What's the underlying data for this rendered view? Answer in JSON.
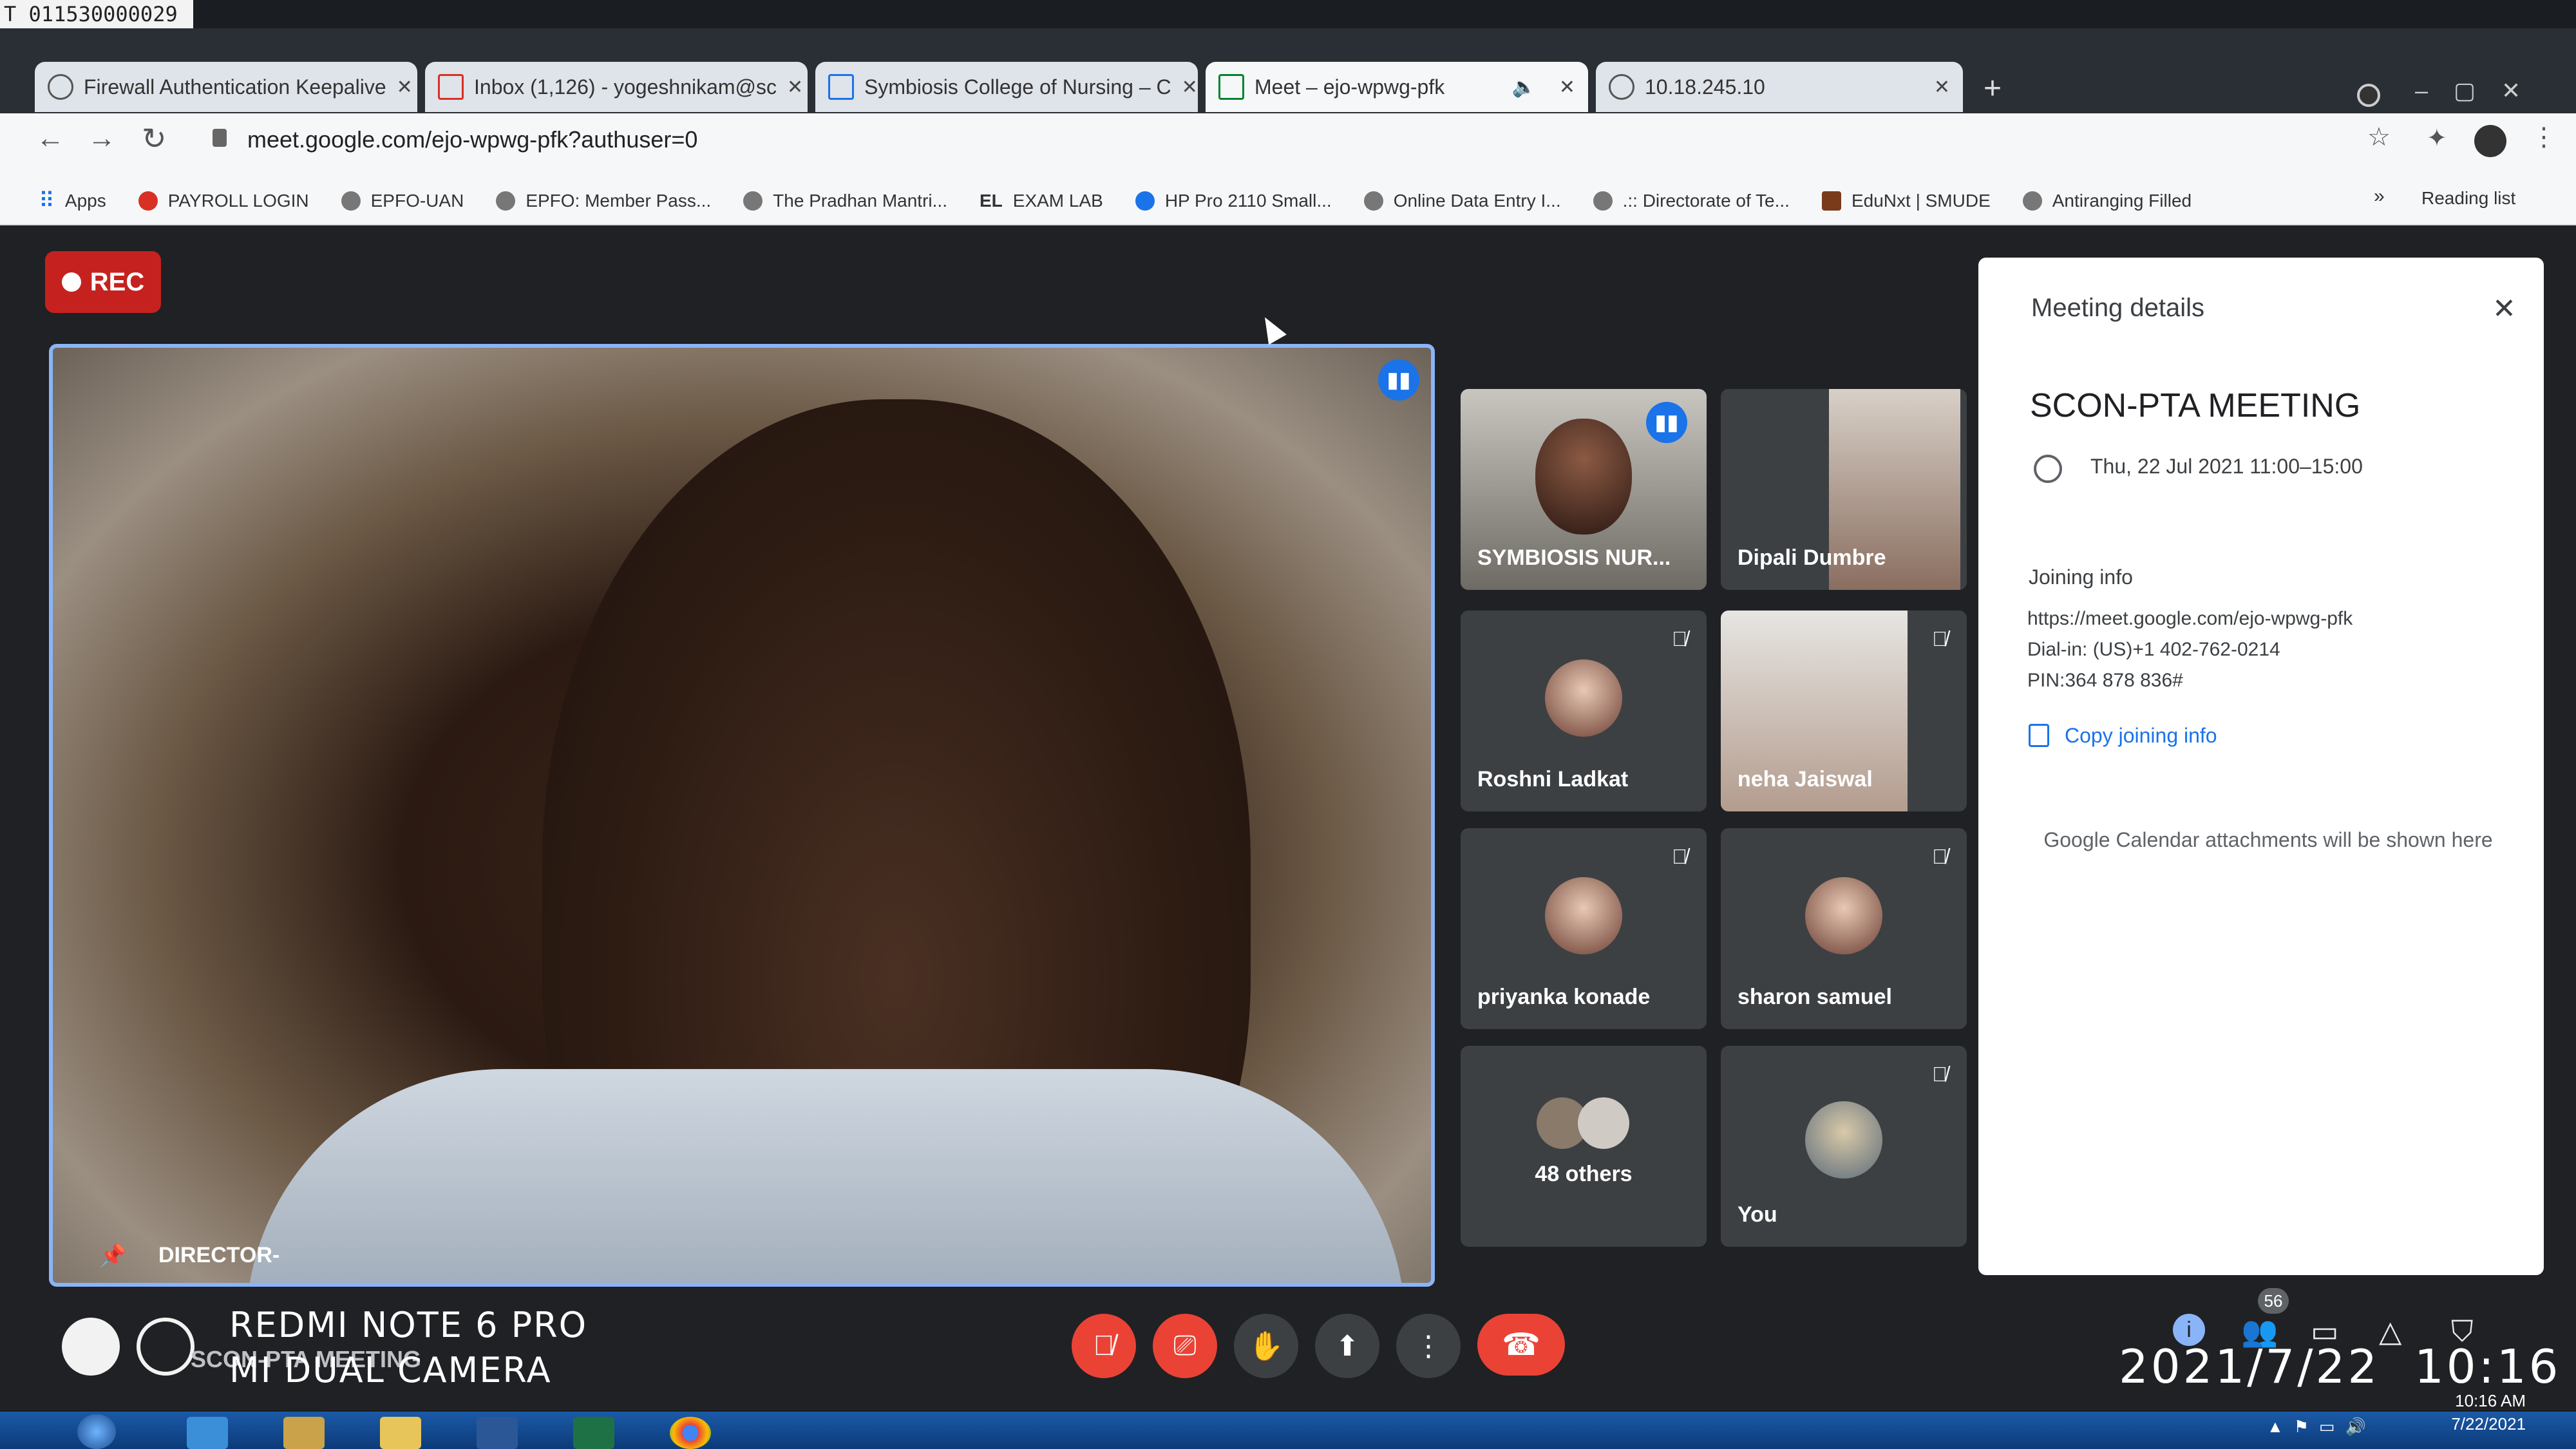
{
  "corner_label": "T 011530000029",
  "tabs": [
    {
      "title": "Firewall Authentication Keepalive"
    },
    {
      "title": "Inbox (1,126) - yogeshnikam@sc"
    },
    {
      "title": "Symbiosis College of Nursing – C"
    },
    {
      "title": "Meet – ejo-wpwg-pfk"
    },
    {
      "title": "10.18.245.10"
    }
  ],
  "address_bar": {
    "url": "meet.google.com/ejo-wpwg-pfk?authuser=0"
  },
  "bookmarks": [
    "Apps",
    "PAYROLL LOGIN",
    "EPFO-UAN",
    "EPFO: Member Pass...",
    "The Pradhan Mantri...",
    "EXAM LAB",
    "HP Pro 2110 Small...",
    "Online Data Entry I...",
    ".:: Directorate of Te...",
    "EduNxt | SMUDE",
    "Antiranging Filled"
  ],
  "reading_list": "Reading list",
  "rec_label": "REC",
  "main_speaker": {
    "name": "DIRECTOR-"
  },
  "participants": [
    {
      "name": "SYMBIOSIS NUR..."
    },
    {
      "name": "Dipali Dumbre"
    },
    {
      "name": "Roshni Ladkat"
    },
    {
      "name": "neha Jaiswal"
    },
    {
      "name": "priyanka konade"
    },
    {
      "name": "sharon samuel"
    },
    {
      "name": "48 others"
    },
    {
      "name": "You"
    }
  ],
  "meeting_details": {
    "header": "Meeting details",
    "title": "SCON-PTA MEETING",
    "datetime": "Thu, 22 Jul 2021 11:00–15:00",
    "joining_label": "Joining info",
    "link": "https://meet.google.com/ejo-wpwg-pfk",
    "dial_in": "Dial-in: (US)+1 402-762-0214",
    "pin": "PIN:364 878 836#",
    "copy_label": "Copy joining info",
    "attachments_note": "Google Calendar attachments will be shown here"
  },
  "bottom_meeting_name": "SCON-PTA MEETING",
  "watermark": {
    "line1": "REDMI NOTE 6 PRO",
    "line2": "MI DUAL CAMERA"
  },
  "photo_timestamp": "2021/7/22  10:16",
  "taskbar_clock": {
    "time": "10:16 AM",
    "date": "7/22/2021"
  },
  "people_count": "56"
}
